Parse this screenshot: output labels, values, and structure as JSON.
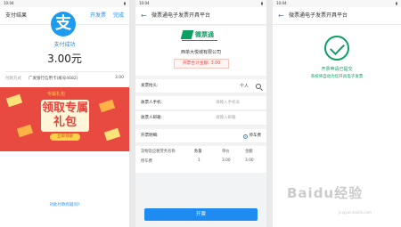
{
  "screen1": {
    "status_time": "10:04",
    "title": "支付结果",
    "link_invoice": "开发票",
    "link_done": "完成",
    "logo_glyph": "支",
    "pay_status": "支付成功",
    "amount": "3.00元",
    "method_label": "付款方式",
    "method_value": "广发银行信用卡(尾号4682)",
    "method_amount": "3.00",
    "promo_tag": "专属礼包",
    "promo_title": "领取专属礼包",
    "promo_button": "立即领取",
    "bottom_link": "对此付款有疑问?"
  },
  "screen2": {
    "status_time": "10:04",
    "title": "微票通电子发票开具平台",
    "brand_name": "微票通",
    "company": "西单大悦城有限公司",
    "total_label": "开票合计金额: 3.00",
    "fields": {
      "invoice_title_label": "发票抬头:",
      "invoice_title_value": "个人",
      "phone_label": "收票人手机:",
      "phone_placeholder": "请输入手机号",
      "email_label": "收票人邮箱:",
      "email_placeholder": "请输入邮箱",
      "detail_label": "开票明细:",
      "detail_option": "停车费"
    },
    "table": {
      "headers": [
        "货物及应税劳务名称",
        "数量",
        "单价",
        "金额"
      ],
      "rows": [
        [
          "停车费",
          "1",
          "3.00",
          "3.00"
        ]
      ]
    },
    "submit": "开票"
  },
  "screen3": {
    "status_time": "10:04",
    "title": "微票通电子发票开具平台",
    "msg1": "开票申请已提交",
    "msg2": "系统将自动为您开具电子发票"
  },
  "watermark": "Baidu经验",
  "watermark_sub": "jingyan.baidu.com"
}
